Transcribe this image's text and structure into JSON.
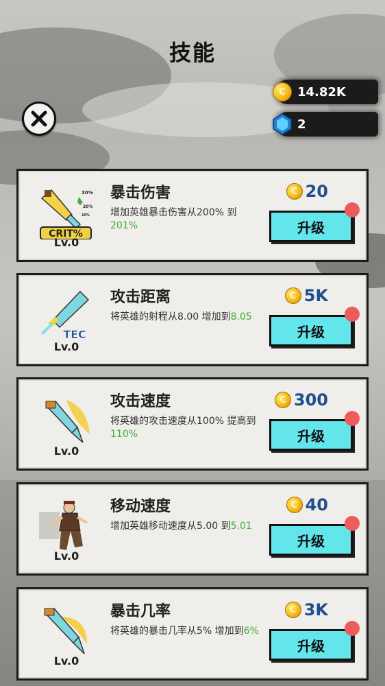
{
  "title": "技能",
  "currency": {
    "coins": "14.82K",
    "gems": "2"
  },
  "upgrade_label": "升级",
  "skills": [
    {
      "name": "暴击伤害",
      "level": "Lv.0",
      "price": "20",
      "desc_pre": "增加英雄暴击伤害从200% 到",
      "desc_val": "201%",
      "icon": "crit-sword-icon",
      "badge": "CRIT%"
    },
    {
      "name": "攻击距离",
      "level": "Lv.0",
      "price": "5K",
      "desc_pre": "将英雄的射程从8.00 增加到",
      "desc_val": "8.05",
      "icon": "tec-sword-icon",
      "badge": "TEC"
    },
    {
      "name": "攻击速度",
      "level": "Lv.0",
      "price": "300",
      "desc_pre": "将英雄的攻击速度从100% 提高到",
      "desc_val": "110%",
      "icon": "speed-sword-icon",
      "badge": ""
    },
    {
      "name": "移动速度",
      "level": "Lv.0",
      "price": "40",
      "desc_pre": "增加英雄移动速度从5.00 到",
      "desc_val": "5.01",
      "icon": "running-hero-icon",
      "badge": ""
    },
    {
      "name": "暴击几率",
      "level": "Lv.0",
      "price": "3K",
      "desc_pre": "将英雄的暴击几率从5% 增加到",
      "desc_val": "6%",
      "icon": "crit-chance-sword-icon",
      "badge": ""
    }
  ],
  "crit_small": [
    "30%",
    "20%",
    "10%"
  ],
  "colors": {
    "button": "#62e6ec",
    "notify_dot": "#ef5b5b",
    "price": "#1f4f8f",
    "highlight": "#3fae3a"
  }
}
